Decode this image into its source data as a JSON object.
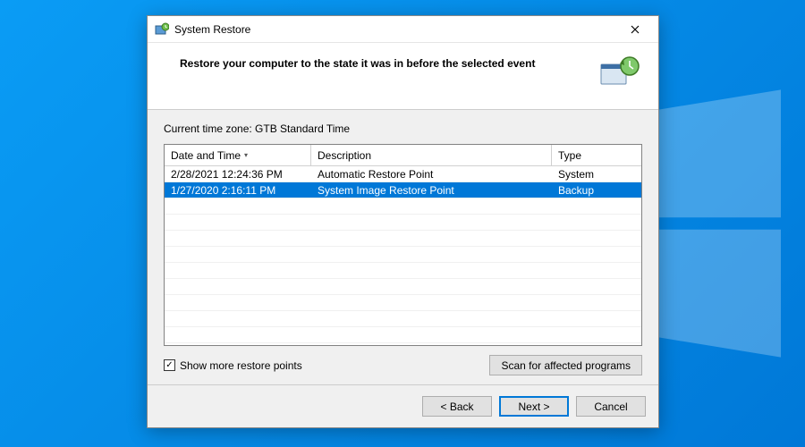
{
  "window": {
    "title": "System Restore"
  },
  "header": {
    "heading": "Restore your computer to the state it was in before the selected event"
  },
  "content": {
    "timezone_label": "Current time zone: GTB Standard Time",
    "columns": {
      "date": "Date and Time",
      "desc": "Description",
      "type": "Type"
    },
    "rows": [
      {
        "date": "2/28/2021 12:24:36 PM",
        "desc": "Automatic Restore Point",
        "type": "System",
        "selected": false
      },
      {
        "date": "1/27/2020 2:16:11 PM",
        "desc": "System Image Restore Point",
        "type": "Backup",
        "selected": true
      }
    ],
    "checkbox": {
      "checked": true,
      "label": "Show more restore points"
    },
    "scan_button": "Scan for affected programs"
  },
  "footer": {
    "back": "< Back",
    "next": "Next >",
    "cancel": "Cancel"
  }
}
